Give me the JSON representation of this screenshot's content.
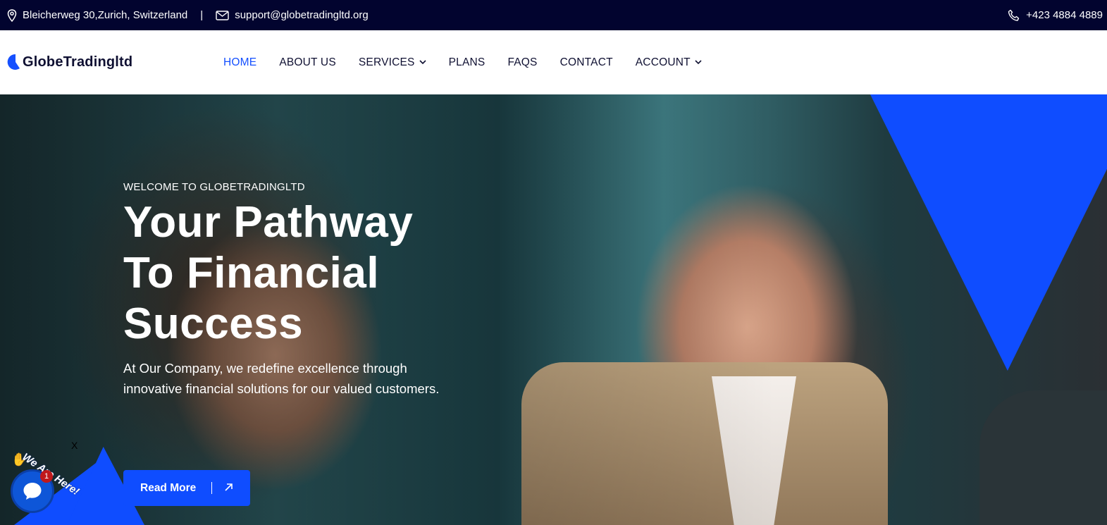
{
  "topbar": {
    "address": "Bleicherweg 30,Zurich, Switzerland",
    "separator": "|",
    "email": "support@globetradingltd.org",
    "phone": "+423 4884 4889"
  },
  "header": {
    "logo_text": "GlobeTradingltd",
    "nav": [
      {
        "label": "HOME",
        "active": true
      },
      {
        "label": "ABOUT US"
      },
      {
        "label": "SERVICES",
        "dropdown": true
      },
      {
        "label": "PLANS"
      },
      {
        "label": "FAQS"
      },
      {
        "label": "CONTACT"
      },
      {
        "label": "ACCOUNT",
        "dropdown": true
      }
    ]
  },
  "hero": {
    "eyebrow": "WELCOME TO GLOBETRADINGLTD",
    "headline_line1": "Your Pathway",
    "headline_line2": "To Financial",
    "headline_line3": "Success",
    "subtext": "At Our Company, we redefine excellence through innovative financial solutions for our valued customers.",
    "cta_label": "Read More"
  },
  "chat": {
    "label": "We Are Here!",
    "badge_count": "1",
    "close": "X"
  },
  "colors": {
    "topbar_bg": "#02042f",
    "accent": "#0f4dff",
    "nav_active": "#1550ff",
    "text_dark": "#0f1032"
  }
}
